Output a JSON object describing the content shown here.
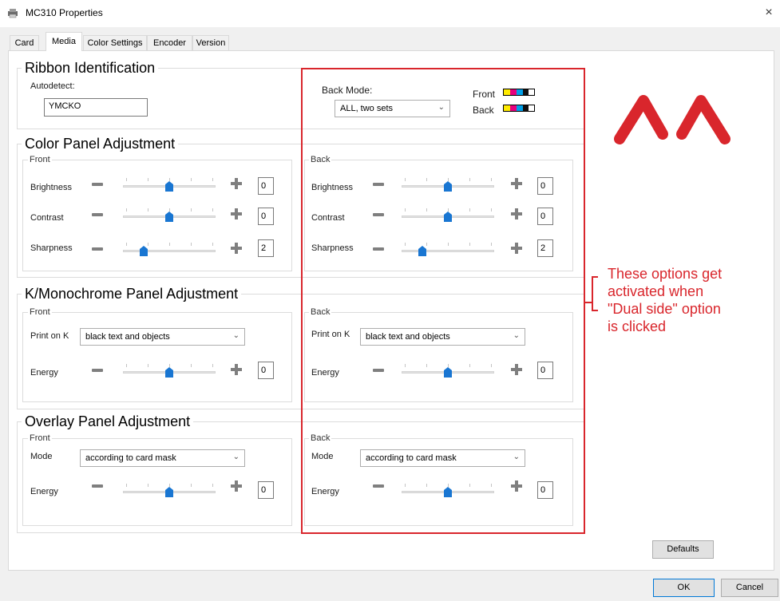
{
  "window": {
    "title": "MC310 Properties",
    "close": "×"
  },
  "tabs": [
    "Card",
    "Media",
    "Color Settings",
    "Encoder",
    "Version"
  ],
  "ribbon": {
    "title": "Ribbon Identification",
    "autodetect_label": "Autodetect:",
    "autodetect_value": "YMCKO",
    "back_mode_label": "Back Mode:",
    "back_mode_value": "ALL, two sets",
    "front_label": "Front",
    "back_label": "Back"
  },
  "color_panel": {
    "title": "Color Panel Adjustment",
    "front": {
      "title": "Front",
      "rows": [
        {
          "label": "Brightness",
          "value": "0",
          "level": 0.5
        },
        {
          "label": "Contrast",
          "value": "0",
          "level": 0.5
        },
        {
          "label": "Sharpness",
          "value": "2",
          "level": 0.2
        }
      ]
    },
    "back": {
      "title": "Back",
      "rows": [
        {
          "label": "Brightness",
          "value": "0",
          "level": 0.5
        },
        {
          "label": "Contrast",
          "value": "0",
          "level": 0.5
        },
        {
          "label": "Sharpness",
          "value": "2",
          "level": 0.2
        }
      ]
    }
  },
  "k_panel": {
    "title": "K/Monochrome Panel Adjustment",
    "front": {
      "title": "Front",
      "print_on_k_label": "Print on K",
      "print_on_k_value": "black text and objects",
      "energy_label": "Energy",
      "energy_value": "0",
      "energy_level": 0.5
    },
    "back": {
      "title": "Back",
      "print_on_k_label": "Print on K",
      "print_on_k_value": "black text and objects",
      "energy_label": "Energy",
      "energy_value": "0",
      "energy_level": 0.5
    }
  },
  "overlay_panel": {
    "title": "Overlay Panel Adjustment",
    "front": {
      "title": "Front",
      "mode_label": "Mode",
      "mode_value": "according to card mask",
      "energy_label": "Energy",
      "energy_value": "0",
      "energy_level": 0.5
    },
    "back": {
      "title": "Back",
      "mode_label": "Mode",
      "mode_value": "according to card mask",
      "energy_label": "Energy",
      "energy_value": "0",
      "energy_level": 0.5
    }
  },
  "annotation": {
    "text": "These options get\nactivated when\n\"Dual side\" option\nis clicked",
    "color": "#d9262c"
  },
  "buttons": {
    "defaults": "Defaults",
    "ok": "OK",
    "cancel": "Cancel"
  },
  "colors": {
    "accent_red": "#d9262c",
    "slider_thumb": "#1976d2",
    "ribbon_panels": [
      "#ffeb00",
      "#e6007e",
      "#00a0e9",
      "#111111",
      "#ffffff"
    ]
  },
  "icons": {
    "window_icon": "printer-icon",
    "logo": "brand-logo-icon"
  }
}
